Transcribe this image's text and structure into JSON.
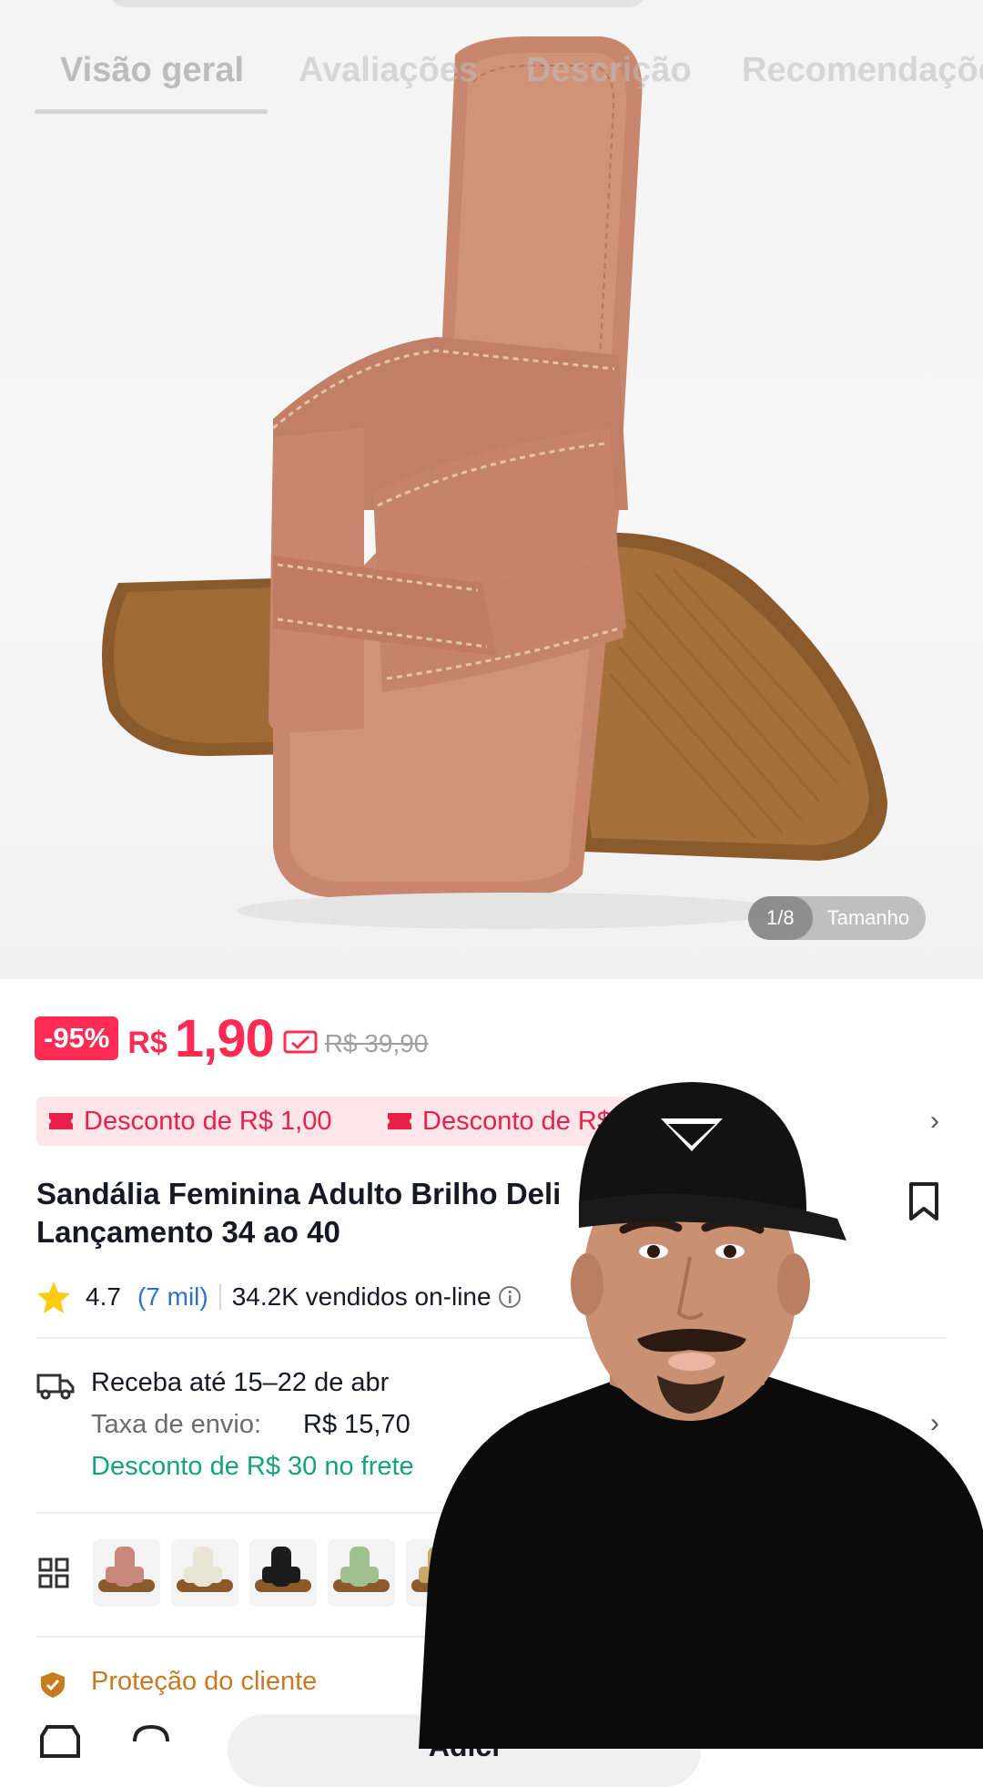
{
  "tabs": [
    "Visão geral",
    "Avaliações",
    "Descrição",
    "Recomendações"
  ],
  "gallery": {
    "counter": "1/8",
    "label": "Tamanho",
    "current": 1,
    "total": 8
  },
  "price": {
    "discount_badge": "-95%",
    "currency": "R$",
    "current": "1,90",
    "original": "R$ 39,90"
  },
  "coupons": [
    "Desconto de R$ 1,00",
    "Desconto de R$"
  ],
  "product": {
    "title_line1": "Sandália Feminina Adulto Brilho Deli",
    "title_line2": "Lançamento 34 ao 40"
  },
  "rating": {
    "score": "4.7",
    "reviews": "(7 mil)",
    "sold": "34.2K vendidos on-line"
  },
  "shipping": {
    "delivery": "Receba até 15–22 de abr",
    "fee_label": "Taxa de envio:",
    "fee_value": "R$ 15,70",
    "discount": "Desconto de R$ 30 no frete"
  },
  "variants": [
    {
      "name": "rose",
      "color": "#c9867a"
    },
    {
      "name": "cream",
      "color": "#e9e4d3"
    },
    {
      "name": "black",
      "color": "#1c1c1c"
    },
    {
      "name": "green",
      "color": "#9fc08f"
    },
    {
      "name": "gold",
      "color": "#c9a86a"
    }
  ],
  "protection": {
    "label": "Proteção do cliente"
  },
  "actions": {
    "add_label": "Adici"
  },
  "colors": {
    "accent": "#fe2c55",
    "green": "#14a37f",
    "link": "#2f6fd6"
  }
}
